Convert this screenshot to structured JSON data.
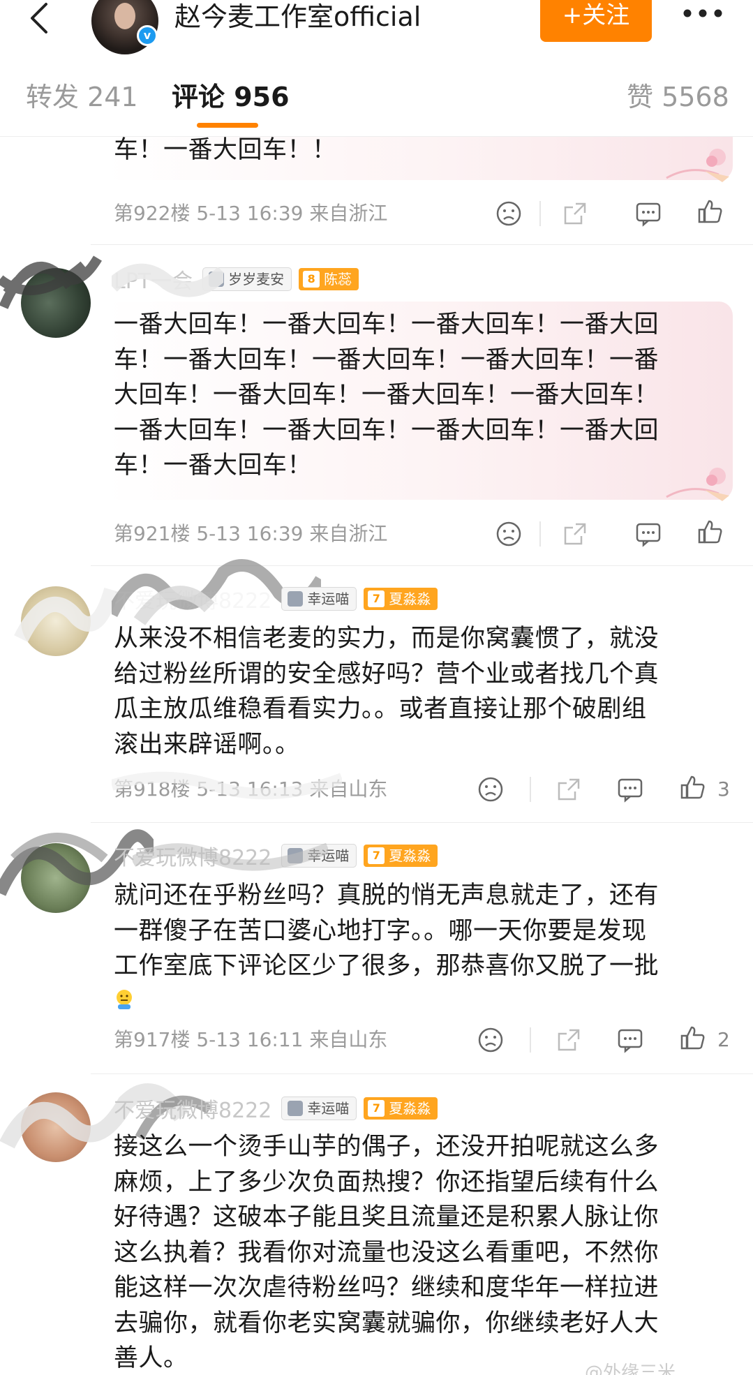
{
  "header": {
    "account_name": "赵今麦工作室official",
    "follow_label": "+关注"
  },
  "tabs": {
    "repost": "转发 241",
    "comments": "评论 956",
    "likes": "赞 5568"
  },
  "colors": {
    "accent": "#ff8200",
    "verified": "#1d9bf0",
    "level_badge": "#ffa51f"
  },
  "comments": [
    {
      "text": "车！一番大回车！！",
      "floor": "第922楼",
      "time": "5-13 16:39",
      "location": "来自浙江",
      "likes": ""
    },
    {
      "user": "LPT一会",
      "fan_badge": "岁岁麦安",
      "level": "8",
      "level_name": "陈蕊",
      "lines": [
        "一番大回车！一番大回车！一番大回车！一番大回",
        "车！一番大回车！一番大回车！一番大回车！一番",
        "大回车！一番大回车！一番大回车！一番大回车！",
        "一番大回车！一番大回车！一番大回车！一番大回",
        "车！一番大回车！"
      ],
      "floor": "第921楼",
      "time": "5-13 16:39",
      "location": "来自浙江",
      "likes": ""
    },
    {
      "user": "不爱玩微博8222",
      "fan_badge": "幸运喵",
      "level": "7",
      "level_name": "夏淼淼",
      "lines": [
        "从来没不相信老麦的实力，而是你窝囊惯了，就没",
        "给过粉丝所谓的安全感好吗？营个业或者找几个真",
        "瓜主放瓜维稳看看实力。。或者直接让那个破剧组",
        "滚出来辟谣啊。。"
      ],
      "floor": "第918楼",
      "time": "5-13 16:13",
      "location": "来自山东",
      "likes": "3"
    },
    {
      "user": "不爱玩微博8222",
      "fan_badge": "幸运喵",
      "level": "7",
      "level_name": "夏淼淼",
      "lines": [
        "就问还在乎粉丝吗？真脱的悄无声息就走了，还有",
        "一群傻子在苦口婆心地打字。。哪一天你要是发现",
        "工作室底下评论区少了很多，那恭喜你又脱了一批"
      ],
      "floor": "第917楼",
      "time": "5-13 16:11",
      "location": "来自山东",
      "likes": "2"
    },
    {
      "user": "不爱玩微博8222",
      "fan_badge": "幸运喵",
      "level": "7",
      "level_name": "夏淼淼",
      "lines": [
        "接这么一个烫手山芋的偶子，还没开拍呢就这么多",
        "麻烦，上了多少次负面热搜？你还指望后续有什么",
        "好待遇？这破本子能且奖且流量还是积累人脉让你",
        "这么执着？我看你对流量也没这么看重吧，不然你",
        "能这样一次次虐待粉丝吗？继续和度华年一样拉进",
        "去骗你，就看你老实窝囊就骗你，你继续老好人大",
        "善人。"
      ]
    }
  ],
  "watermark": "@外缘三米"
}
